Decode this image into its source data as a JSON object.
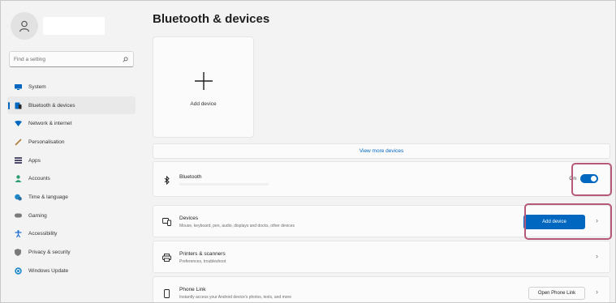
{
  "sidebar": {
    "search_placeholder": "Find a setting",
    "items": [
      {
        "label": "System",
        "icon": "display-icon",
        "color": "#0067c0"
      },
      {
        "label": "Bluetooth & devices",
        "icon": "bluetooth-devices-icon",
        "color": "#0067c0",
        "active": true
      },
      {
        "label": "Network & internet",
        "icon": "network-icon",
        "color": "#0067c0"
      },
      {
        "label": "Personalisation",
        "icon": "pen-icon",
        "color": "#b07b3a"
      },
      {
        "label": "Apps",
        "icon": "apps-icon",
        "color": "#5a5a7a"
      },
      {
        "label": "Accounts",
        "icon": "person-icon",
        "color": "#2b9e6f"
      },
      {
        "label": "Time & language",
        "icon": "globe-clock-icon",
        "color": "#1e88c9"
      },
      {
        "label": "Gaming",
        "icon": "gamepad-icon",
        "color": "#7a7a7a"
      },
      {
        "label": "Accessibility",
        "icon": "accessibility-icon",
        "color": "#1e6fd0"
      },
      {
        "label": "Privacy & security",
        "icon": "shield-icon",
        "color": "#7a7a7a"
      },
      {
        "label": "Windows Update",
        "icon": "update-icon",
        "color": "#1e88c9"
      }
    ]
  },
  "main": {
    "title": "Bluetooth & devices",
    "add_tile_label": "Add device",
    "view_more": "View more devices",
    "bluetooth": {
      "title": "Bluetooth",
      "state_label": "On",
      "state": "on"
    },
    "devices": {
      "title": "Devices",
      "subtitle": "Mouse, keyboard, pen, audio, displays and docks, other devices",
      "button": "Add device"
    },
    "printers": {
      "title": "Printers & scanners",
      "subtitle": "Preferences, troubleshoot"
    },
    "phone": {
      "title": "Phone Link",
      "subtitle": "Instantly access your Android device's photos, texts, and more",
      "button": "Open Phone Link"
    }
  },
  "colors": {
    "accent": "#0067c0",
    "highlight": "#b5597a"
  }
}
